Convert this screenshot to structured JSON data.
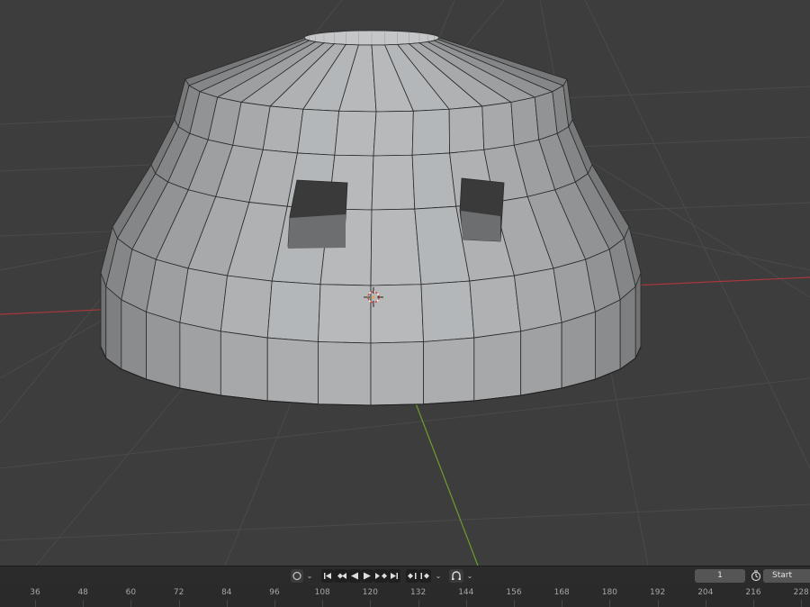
{
  "viewport": {
    "object": "dome-mesh",
    "axis_x_color": "#a8383d",
    "axis_y_color": "#6e9e2c",
    "grid_color": "#4a4a4a",
    "mesh_color": "#b4b6b8",
    "wire_color": "#2a2a2a",
    "background": "#3d3d3d"
  },
  "timeline": {
    "controls": {
      "sync_icon": "circle-icon",
      "jump_start": "jump-to-start-icon",
      "prev_keyframe": "previous-keyframe-icon",
      "play_reverse": "play-reverse-icon",
      "play": "play-icon",
      "next_keyframe": "next-keyframe-icon",
      "jump_end": "jump-to-end-icon",
      "key_left": "keyframe-left-icon",
      "key_right": "keyframe-right-icon",
      "autokey": "auto-keying-icon"
    },
    "current_frame": "1",
    "start_label": "Start",
    "ruler_ticks": [
      "36",
      "48",
      "60",
      "72",
      "84",
      "96",
      "108",
      "120",
      "132",
      "144",
      "156",
      "168",
      "180",
      "192",
      "204",
      "216",
      "228"
    ]
  }
}
